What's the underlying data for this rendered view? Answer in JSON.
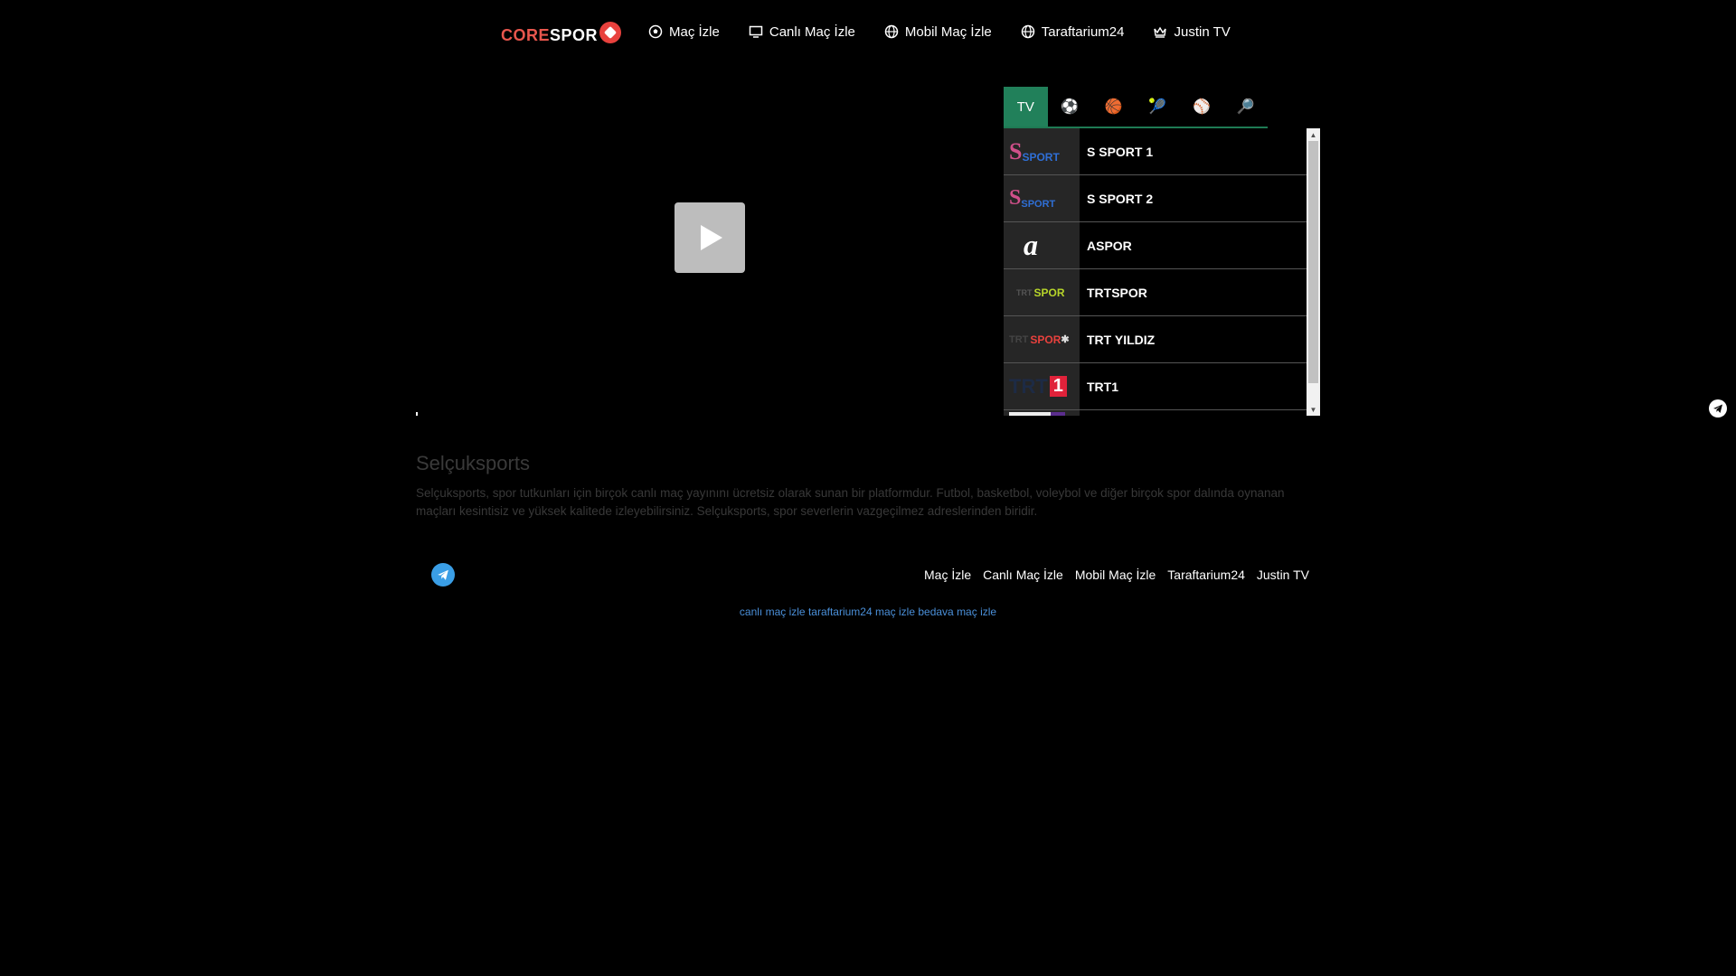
{
  "logo": {
    "part1": "CORE",
    "part2": "SPOR"
  },
  "nav": [
    {
      "label": "Maç İzle",
      "icon": "soccer-ball-icon"
    },
    {
      "label": "Canlı Maç İzle",
      "icon": "screen-icon"
    },
    {
      "label": "Mobil Maç İzle",
      "icon": "globe-icon"
    },
    {
      "label": "Taraftarium24",
      "icon": "globe-icon"
    },
    {
      "label": "Justin TV",
      "icon": "crown-icon"
    }
  ],
  "tabs": [
    {
      "label": "TV",
      "icon": "tv-tab"
    },
    {
      "label": "⚽",
      "icon": "soccer-ball-icon"
    },
    {
      "label": "🏀",
      "icon": "basketball-icon"
    },
    {
      "label": "🎾",
      "icon": "tennis-icon"
    },
    {
      "label": "⚾",
      "icon": "baseball-icon"
    },
    {
      "label": "🔎",
      "icon": "search-icon"
    }
  ],
  "channels": [
    {
      "name": "S SPORT 1",
      "logo": "SPORT",
      "logo_color": "#2f6fd6"
    },
    {
      "name": "S SPORT 2",
      "logo": "SPORT",
      "logo_color": "#2f6fd6"
    },
    {
      "name": "ASPOR",
      "logo": "a",
      "logo_color": "#ffffff"
    },
    {
      "name": "TRTSPOR",
      "logo": "SPOR",
      "logo_color": "#b7d52a"
    },
    {
      "name": "TRT YILDIZ",
      "logo": "SPOR",
      "logo_color": "#e8413d"
    },
    {
      "name": "TRT1",
      "logo": "1",
      "logo_color": "#e0223a"
    }
  ],
  "article": {
    "title": "Selçuksports",
    "text": "Selçuksports, spor tutkunları için birçok canlı maç yayınını ücretsiz olarak sunan bir platformdur. Futbol, basketbol, voleybol ve diğer birçok spor dalında oynanan maçları kesintisiz ve yüksek kalitede izleyebilirsiniz. Selçuksports, spor severlerin vazgeçilmez adreslerinden biridir."
  },
  "footer": {
    "links": [
      "Maç İzle",
      "Canlı Maç İzle",
      "Mobil Maç İzle",
      "Taraftarium24",
      "Justin TV"
    ],
    "tags": [
      "canlı maç izle",
      "taraftarium24",
      "maç izle",
      "bedava maç izle"
    ]
  },
  "colors": {
    "accent": "#21805a",
    "brand": "#e8564d",
    "link": "#4a8fd8"
  }
}
